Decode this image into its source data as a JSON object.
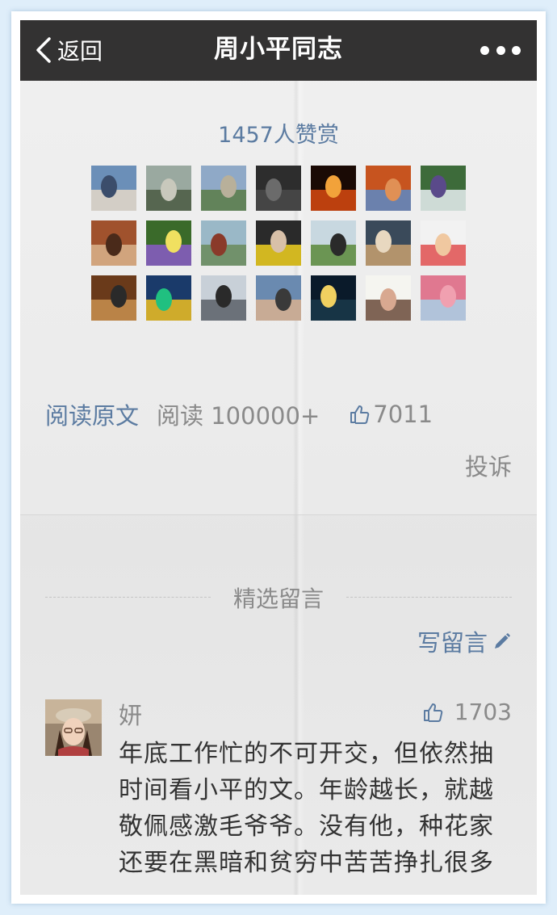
{
  "navbar": {
    "back_label": "返回",
    "title": "周小平同志"
  },
  "reward": {
    "count_text": "1457人赞赏",
    "avatars": [
      {
        "icon": "avatar-man-shirt",
        "colors": [
          "#6b8fb8",
          "#e5d9c8",
          "#3b4d6b"
        ]
      },
      {
        "icon": "avatar-man-road",
        "colors": [
          "#9aa9a0",
          "#4a5a42",
          "#c8c8bc"
        ]
      },
      {
        "icon": "avatar-road-landscape",
        "colors": [
          "#8fa9c7",
          "#5a7d47",
          "#b8b09a"
        ]
      },
      {
        "icon": "avatar-dark-city",
        "colors": [
          "#2d2d2d",
          "#4a4a4a",
          "#6b6b6b"
        ]
      },
      {
        "icon": "avatar-fire-logo",
        "colors": [
          "#1a0a05",
          "#d94a10",
          "#f2a23a"
        ]
      },
      {
        "icon": "avatar-red-rock-arch",
        "colors": [
          "#c7541f",
          "#5a8ac7",
          "#e09055"
        ]
      },
      {
        "icon": "avatar-waterfall",
        "colors": [
          "#3d6b3a",
          "#e8eef2",
          "#5a4a8a"
        ]
      },
      {
        "icon": "avatar-woman-room",
        "colors": [
          "#a0522d",
          "#d9b38c",
          "#4a2a1a"
        ]
      },
      {
        "icon": "avatar-purple-iris",
        "colors": [
          "#3a6a2a",
          "#8a5ac7",
          "#f0e060"
        ]
      },
      {
        "icon": "avatar-man-lake",
        "colors": [
          "#9ab8c7",
          "#6a8a5a",
          "#8a3a2a"
        ]
      },
      {
        "icon": "avatar-woman-yellow",
        "colors": [
          "#2a2a2a",
          "#f0d020",
          "#d8c0a8"
        ]
      },
      {
        "icon": "avatar-man-tea-field",
        "colors": [
          "#c8d8e0",
          "#5a8a3a",
          "#2a2a2a"
        ]
      },
      {
        "icon": "avatar-cat",
        "colors": [
          "#3a4a5a",
          "#c8a070",
          "#e8d8c0"
        ]
      },
      {
        "icon": "avatar-baby-hat",
        "colors": [
          "#f2f2f2",
          "#e05050",
          "#f0c8a0"
        ]
      },
      {
        "icon": "avatar-man-reading",
        "colors": [
          "#6a3a1a",
          "#c89050",
          "#2a2a2a"
        ]
      },
      {
        "icon": "avatar-neon-boat",
        "colors": [
          "#1a3a6a",
          "#f0c020",
          "#20c080"
        ]
      },
      {
        "icon": "avatar-man-skyline",
        "colors": [
          "#c8d0d8",
          "#5a6068",
          "#2a2a2a"
        ]
      },
      {
        "icon": "avatar-family-selfie",
        "colors": [
          "#6a8ab0",
          "#d8b090",
          "#3a3a3a"
        ]
      },
      {
        "icon": "avatar-moon-night",
        "colors": [
          "#0a1a2a",
          "#1a3a4a",
          "#f0d060"
        ]
      },
      {
        "icon": "avatar-drawn-girl",
        "colors": [
          "#f5f5f0",
          "#6a4a3a",
          "#d8a890"
        ]
      },
      {
        "icon": "avatar-pink-building",
        "colors": [
          "#e07890",
          "#a8d0e8",
          "#f0a0b0"
        ]
      }
    ]
  },
  "meta": {
    "read_original": "阅读原文",
    "read_count": "阅读 100000+",
    "like_count": "7011",
    "report": "投诉"
  },
  "comments": {
    "section_title": "精选留言",
    "write_label": "写留言",
    "items": [
      {
        "avatar_icon": "avatar-woman-hat",
        "name": "妍",
        "likes": "1703",
        "text": "年底工作忙的不可开交，但依然抽时间看小平的文。年龄越长，就越敬佩感激毛爷爷。没有他，种花家还要在黑暗和贫穷中苦苦挣扎很多"
      }
    ]
  },
  "colors": {
    "navbar_bg": "#333232",
    "link_blue": "#5b7ba1",
    "muted_text": "#8a8a8a",
    "body_text": "#333333",
    "outer_bg": "#dfeefa"
  }
}
